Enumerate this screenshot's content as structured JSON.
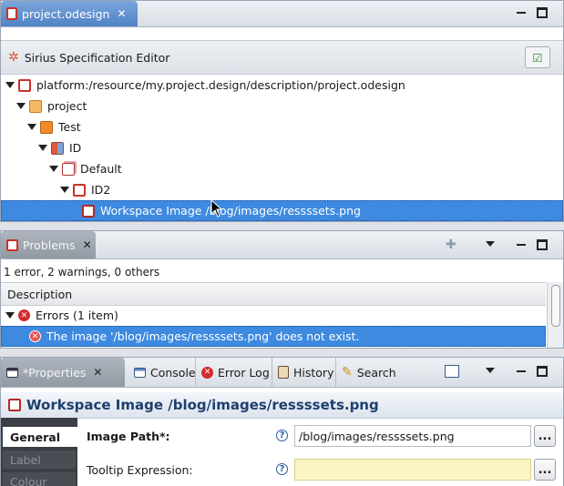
{
  "editor": {
    "tab_label": "project.odesign",
    "header_title": "Sirius Specification Editor",
    "tree": [
      {
        "label": "platform:/resource/my.project.design/description/project.odesign",
        "icon": "odesign-file-icon"
      },
      {
        "label": "project",
        "icon": "viewpoint-folder-icon"
      },
      {
        "label": "Test",
        "icon": "viewpoint-icon"
      },
      {
        "label": "ID",
        "icon": "diagram-description-icon"
      },
      {
        "label": "Default",
        "icon": "layer-icon"
      },
      {
        "label": "ID2",
        "icon": "node-mapping-icon"
      },
      {
        "label": "Workspace Image /blog/images/ressssets.png",
        "icon": "workspace-image-icon",
        "selected": true
      }
    ]
  },
  "problems": {
    "tab_label": "Problems",
    "summary": "1 error, 2 warnings, 0 others",
    "column_header": "Description",
    "group_label": "Errors (1 item)",
    "error_message": "The image '/blog/images/ressssets.png' does not exist."
  },
  "bottom_tabs": [
    {
      "label": "*Properties",
      "icon": "properties-icon"
    },
    {
      "label": "Console",
      "icon": "console-icon"
    },
    {
      "label": "Error Log",
      "icon": "error-log-icon"
    },
    {
      "label": "History",
      "icon": "history-icon"
    },
    {
      "label": "Search",
      "icon": "search-icon"
    }
  ],
  "properties": {
    "title": "Workspace Image /blog/images/ressssets.png",
    "side_tabs": [
      "General",
      "Label",
      "Colour"
    ],
    "image_path_label": "Image Path*:",
    "image_path_value": "/blog/images/ressssets.png",
    "tooltip_label": "Tooltip Expression:",
    "tooltip_value": "",
    "browse_label": "...",
    "help_glyph": "?"
  },
  "colors": {
    "selection": "#3d8ae0",
    "tooltip_field_bg": "#fbf5c4",
    "error_red": "#d22a2a"
  }
}
